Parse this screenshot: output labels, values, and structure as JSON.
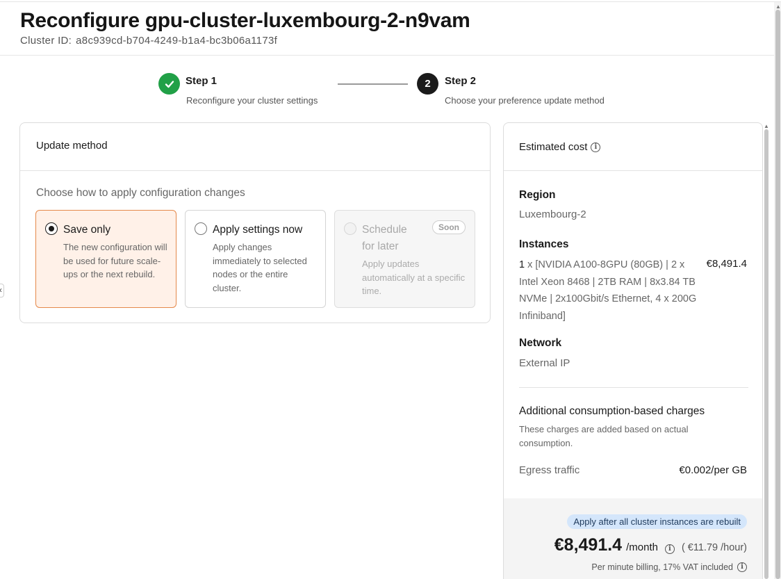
{
  "header": {
    "title": "Reconfigure gpu-cluster-luxembourg-2-n9vam",
    "cluster_id_label": "Cluster ID:",
    "cluster_id_value": "a8c939cd-b704-4249-b1a4-bc3b06a1173f"
  },
  "stepper": {
    "steps": [
      {
        "title": "Step 1",
        "subtitle": "Reconfigure your cluster settings",
        "state": "completed",
        "icon": "check-icon"
      },
      {
        "title": "Step 2",
        "subtitle": "Choose your preference update method",
        "state": "active",
        "number": "2"
      }
    ]
  },
  "update_method": {
    "title": "Update method",
    "subtitle": "Choose how to apply configuration changes",
    "options": [
      {
        "title": "Save only",
        "description": "The new configuration will be used for future scale-ups or the next rebuild.",
        "selected": true,
        "disabled": false
      },
      {
        "title": "Apply settings now",
        "description": "Apply changes immediately to selected nodes or the entire cluster.",
        "selected": false,
        "disabled": false
      },
      {
        "title": "Schedule for later",
        "description": "Apply updates automatically at a specific time.",
        "selected": false,
        "disabled": true,
        "badge": "Soon"
      }
    ]
  },
  "estimated_cost": {
    "title": "Estimated cost",
    "region_label": "Region",
    "region_value": "Luxembourg-2",
    "instances_label": "Instances",
    "instance_qty": "1",
    "instance_desc": " x [NVIDIA A100-8GPU (80GB) | 2 x Intel Xeon 8468 | 2TB RAM | 8x3.84 TB NVMe | 2x100Gbit/s Ethernet, 4 x 200G Infiniband]",
    "instance_price": "€8,491.4",
    "network_label": "Network",
    "network_value": "External IP",
    "additional_title": "Additional consumption-based charges",
    "additional_desc": "These charges are added based on actual consumption.",
    "egress_label": "Egress traffic",
    "egress_price": "€0.002/per GB",
    "rebuild_badge": "Apply after all cluster instances are rebuilt",
    "total_amount": "€8,491.4",
    "total_unit": "/month",
    "hourly": "( €11.79 /hour)",
    "billing_note": "Per minute billing, 17% VAT included"
  },
  "colors": {
    "accent_orange": "#e5884a",
    "selected_bg": "#fff1e8",
    "success_green": "#21a047",
    "badge_blue_bg": "#d4e6fb"
  }
}
